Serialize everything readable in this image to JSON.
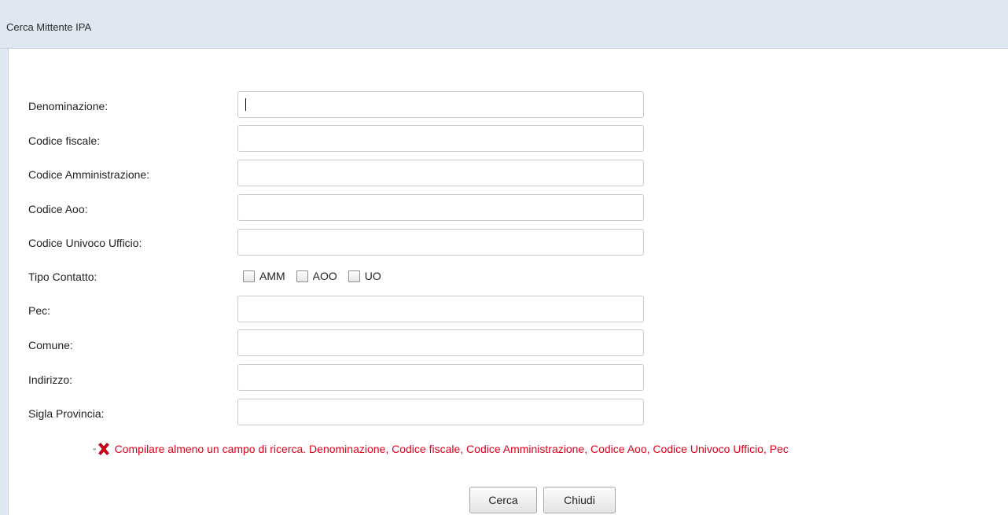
{
  "window": {
    "title": "Cerca Mittente IPA"
  },
  "form": {
    "denominazione": {
      "label": "Denominazione:",
      "value": ""
    },
    "codice_fiscale": {
      "label": "Codice fiscale:",
      "value": ""
    },
    "codice_amministrazione": {
      "label": "Codice Amministrazione:",
      "value": ""
    },
    "codice_aoo": {
      "label": "Codice Aoo:",
      "value": ""
    },
    "codice_univoco_ufficio": {
      "label": "Codice Univoco Ufficio:",
      "value": ""
    },
    "tipo_contatto": {
      "label": "Tipo Contatto:",
      "options": [
        {
          "label": "AMM",
          "checked": false
        },
        {
          "label": "AOO",
          "checked": false
        },
        {
          "label": "UO",
          "checked": false
        }
      ]
    },
    "pec": {
      "label": "Pec:",
      "value": ""
    },
    "comune": {
      "label": "Comune:",
      "value": ""
    },
    "indirizzo": {
      "label": "Indirizzo:",
      "value": ""
    },
    "sigla_provincia": {
      "label": "Sigla Provincia:",
      "value": ""
    }
  },
  "error": {
    "icon": "red-x-icon",
    "color": "#e0001b",
    "message": "Compilare almeno un campo di ricerca. Denominazione, Codice fiscale, Codice Amministrazione, Codice Aoo, Codice Univoco Ufficio, Pec"
  },
  "buttons": {
    "search": "Cerca",
    "close": "Chiudi"
  }
}
